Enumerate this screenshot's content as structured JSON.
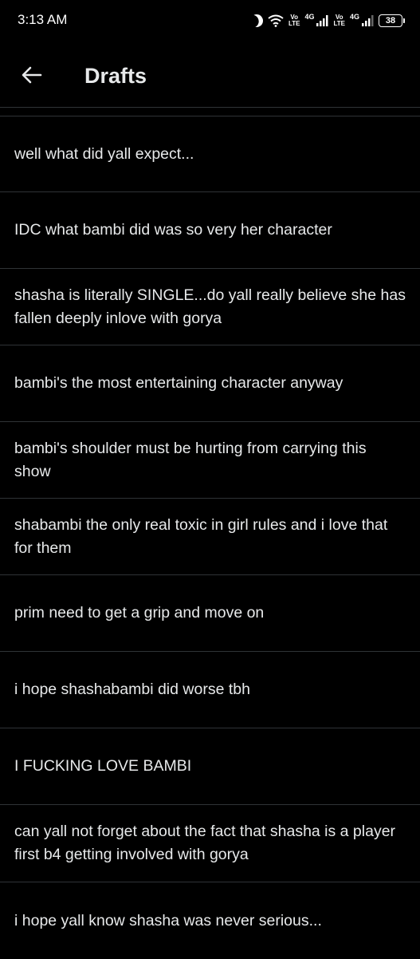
{
  "status_bar": {
    "time": "3:13 AM",
    "volte1": [
      "Vo",
      "LTE"
    ],
    "gen1": "4G",
    "volte2": [
      "Vo",
      "LTE"
    ],
    "gen2": "4G",
    "battery": "38",
    "icons": [
      "moon-icon",
      "wifi-icon",
      "signal-icon",
      "signal-icon",
      "battery-icon"
    ]
  },
  "header": {
    "title": "Drafts",
    "back_icon": "back-arrow-icon"
  },
  "drafts": [
    {
      "text": "well what did yall expect..."
    },
    {
      "text": "IDC what bambi did was so very her character"
    },
    {
      "text": "shasha is literally SINGLE...do yall really believe she has fallen deeply inlove with gorya"
    },
    {
      "text": "bambi's the most entertaining character anyway"
    },
    {
      "text": "bambi's shoulder must be hurting from carrying this show"
    },
    {
      "text": "shabambi the only real toxic in girl rules and i love that for them"
    },
    {
      "text": "prim need to get a grip and move on"
    },
    {
      "text": "i hope shashabambi did worse tbh"
    },
    {
      "text": "I FUCKING LOVE BAMBI"
    },
    {
      "text": "can yall not forget about the fact that shasha is a player first b4 getting involved with gorya"
    },
    {
      "text": "i hope yall know shasha was never serious..."
    }
  ],
  "colors": {
    "background": "#000000",
    "text": "#e7e9ea",
    "divider": "#2f3336"
  }
}
